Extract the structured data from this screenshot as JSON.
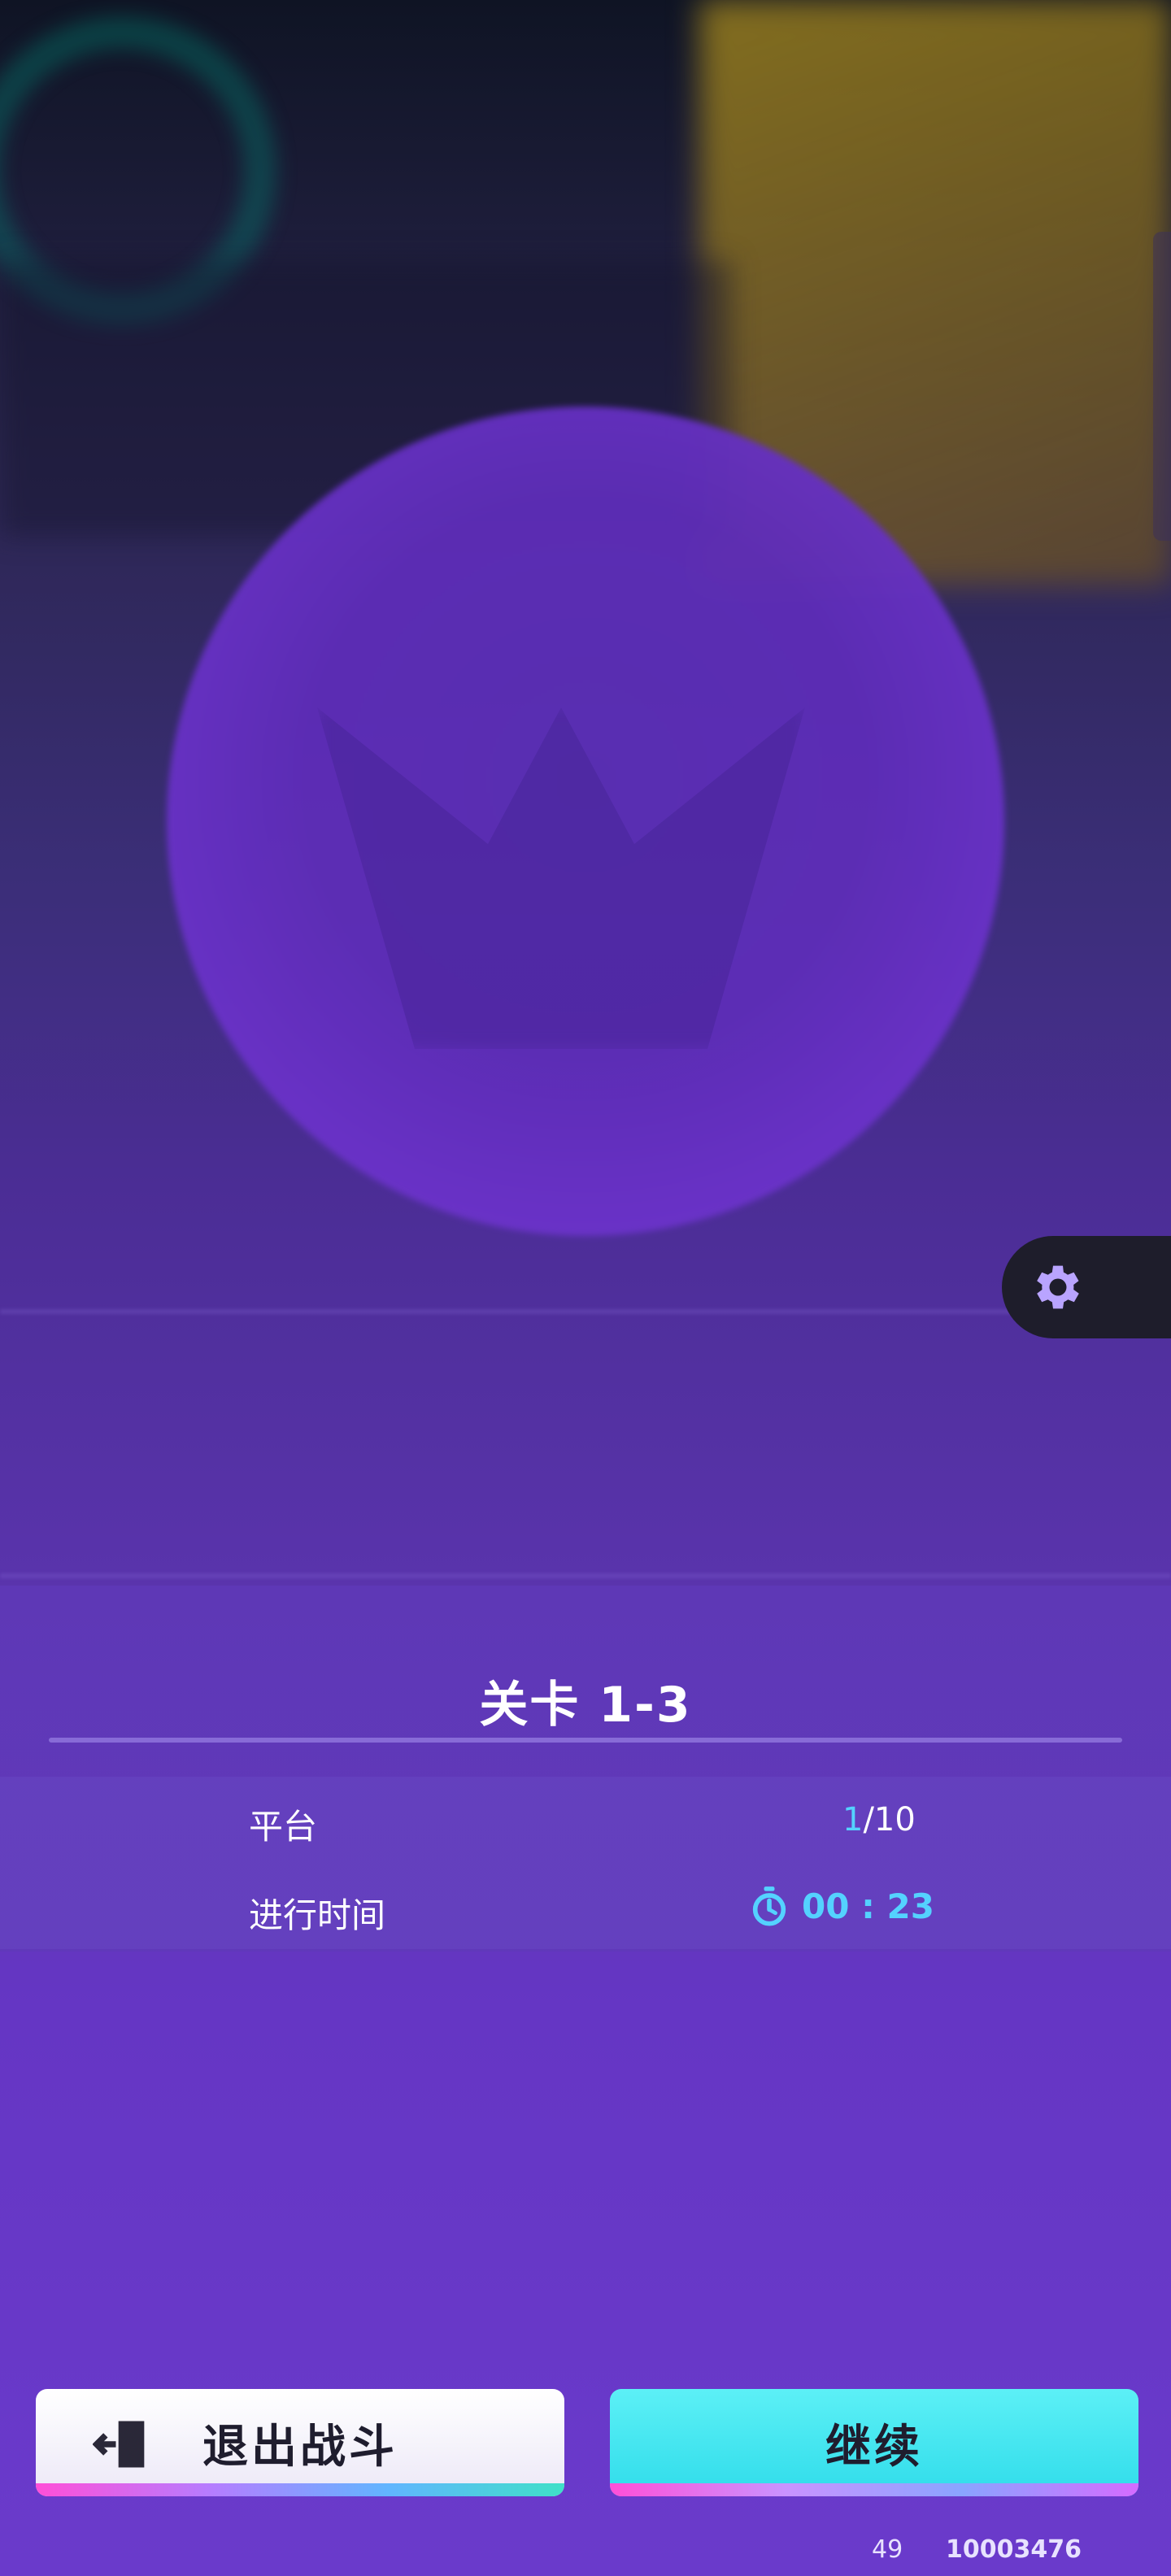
{
  "level": {
    "title": "关卡 1-3"
  },
  "stats": {
    "platform": {
      "label": "平台",
      "current": "1",
      "total": "/10"
    },
    "elapsed": {
      "label": "进行时间",
      "value": "00 : 23"
    }
  },
  "buttons": {
    "exit_label": "退出战斗",
    "continue_label": "继续"
  },
  "footer": {
    "left": "49",
    "right": "10003476"
  },
  "icons": {
    "settings": "gear-icon",
    "timer": "stopwatch-icon",
    "exit": "exit-door-icon"
  },
  "colors": {
    "accent": "#54d2ff",
    "continue_button": "#30dcea",
    "exit_button": "#ffffff",
    "panel": "#5e3ab6"
  }
}
